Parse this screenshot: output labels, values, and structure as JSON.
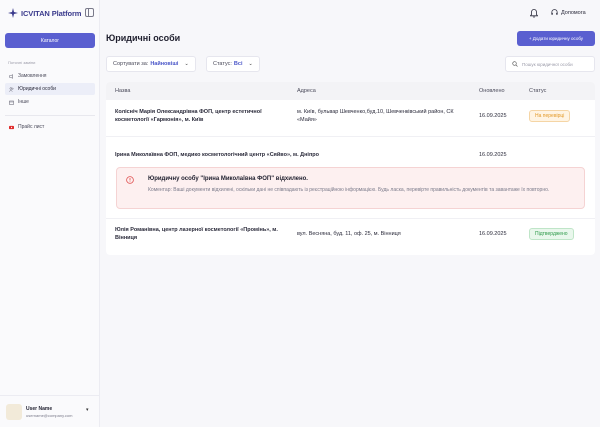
{
  "app": {
    "logo_text": "ICVITAN Platform",
    "catalog_label": "Каталог"
  },
  "sidebar": {
    "section_label": "Поточні заміни",
    "items": [
      {
        "label": "Замовлення",
        "icon": "megaphone-icon"
      },
      {
        "label": "Юридичні особи",
        "icon": "users-icon",
        "active": true
      },
      {
        "label": "Інше",
        "icon": "box-icon"
      }
    ],
    "price_list_label": "Прайс лист",
    "user": {
      "name": "User Name",
      "email": "username@company.com"
    }
  },
  "header": {
    "help_label": "Допомога"
  },
  "page": {
    "title": "Юридичні особи",
    "add_button": "+ Додати юридичну особу",
    "sort_label": "Сортувати за:",
    "sort_value": "Найновіші",
    "status_label": "Статус:",
    "status_value": "Всі",
    "search_placeholder": "Пошук юридичної особи"
  },
  "table": {
    "columns": [
      "Назва",
      "Адреса",
      "Оновлено",
      "Статус"
    ],
    "rows": [
      {
        "name": "Колісніч Марія Олександрівна ФОП, центр естетичної косметології «Гармонія», м. Київ",
        "address": "м. Київ, бульвар Шевченко,буд.10, Шевченківський район, СК «Майя»",
        "updated": "16.09.2025",
        "status": "На перевірці"
      },
      {
        "name": "Ірина Миколаївна ФОП, медико косметологічний центр «Сяйво», м. Дніпро",
        "address": "",
        "updated": "16.09.2025",
        "status": ""
      },
      {
        "name": "Юлія Романівна, центр лазерної косметології «Промінь», м. Вінниця",
        "address": "вул. Весняна, буд. 11, оф. 25, м. Вінниця",
        "updated": "16.09.2025",
        "status": "Підтверджено"
      }
    ]
  },
  "alert": {
    "title": "Юридичну особу \"Ірина Миколаївна ФОП\" відхилено.",
    "text": "Коментар: Ваші документи відхилені, оскільки дані не співпадають із реєстраційною інформацією. Будь ласка, перевірте правильність документів та завантаже їх повторно."
  },
  "colors": {
    "accent": "#5a5fd0",
    "review": "#e39a2a",
    "approved": "#2e9a4a",
    "error": "#e05050"
  }
}
